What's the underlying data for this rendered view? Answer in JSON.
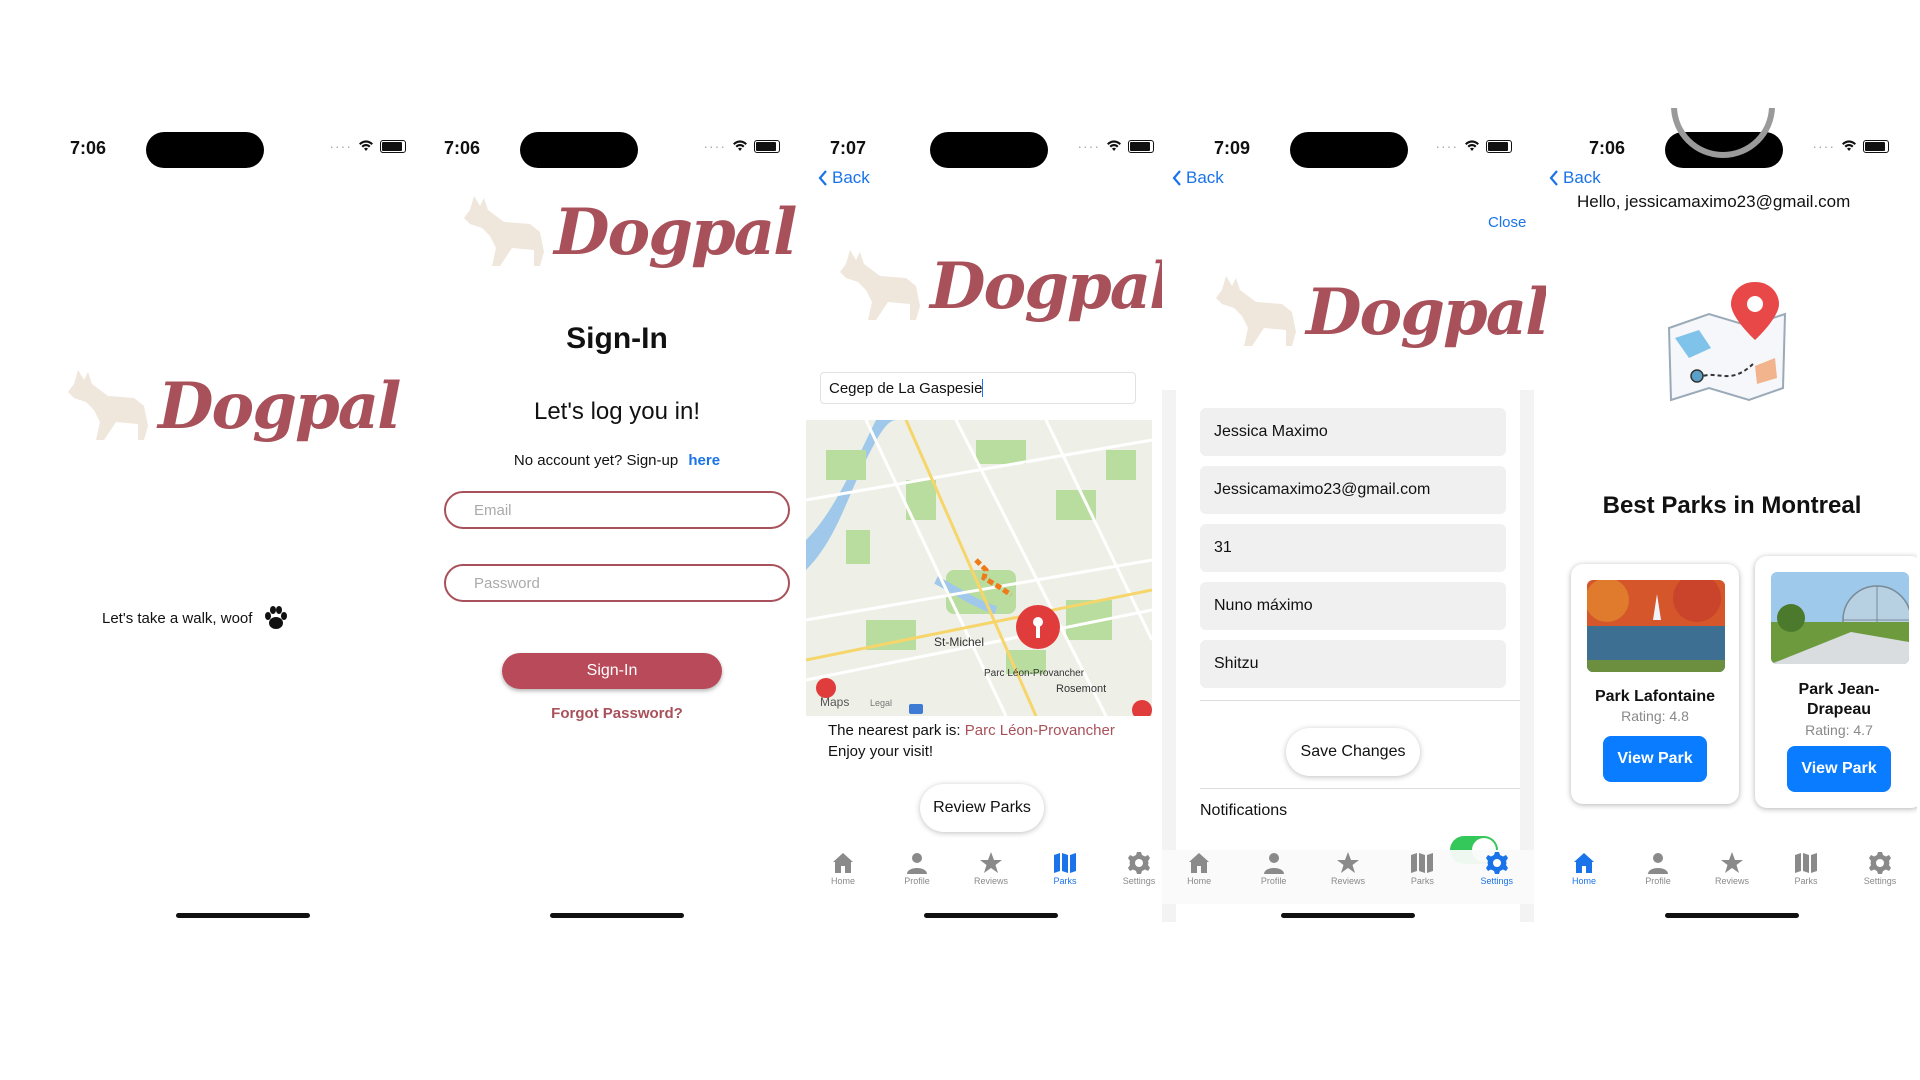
{
  "screens": {
    "splash": {
      "time": "7:06",
      "logo_text": "Dogpal",
      "tagline": "Let's take a walk, woof"
    },
    "signin": {
      "time": "7:06",
      "logo_text": "Dogpal",
      "title": "Sign-In",
      "subtitle": "Let's log you in!",
      "no_account": "No account yet? Sign-up",
      "here_link": "here",
      "email_placeholder": "Email",
      "password_placeholder": "Password",
      "signin_button": "Sign-In",
      "forgot_link": "Forgot Password?"
    },
    "parks": {
      "time": "7:07",
      "back": "Back",
      "logo_text": "Dogpal",
      "search_value": "Cegep de La Gaspesie",
      "map_labels": [
        "St-Michel",
        "Parc Léon-Provancher",
        "Rosemont",
        "Maps",
        "Legal"
      ],
      "nearest_prefix": "The nearest park is:",
      "nearest_park": "Parc Léon-Provancher",
      "enjoy": "Enjoy your visit!",
      "review_button": "Review Parks"
    },
    "settings": {
      "time": "7:09",
      "back": "Back",
      "close": "Close",
      "logo_text": "Dogpal",
      "fields": [
        "Jessica Maximo",
        "Jessicamaximo23@gmail.com",
        "31",
        "Nuno máximo",
        "Shitzu"
      ],
      "save_button": "Save Changes",
      "notifications": "Notifications",
      "toggle_on": true
    },
    "home": {
      "time": "7:06",
      "back": "Back",
      "greeting": "Hello, jessicamaximo23@gmail.com",
      "heading": "Best Parks in Montreal",
      "parks": [
        {
          "name": "Park Lafontaine",
          "rating": "Rating: 4.8",
          "button": "View Park"
        },
        {
          "name": "Park Jean-Drapeau",
          "rating": "Rating: 4.7",
          "button": "View Park"
        }
      ]
    }
  },
  "tabs": [
    "Home",
    "Profile",
    "Reviews",
    "Parks",
    "Settings"
  ],
  "colors": {
    "brand": "#a8515a",
    "accent": "#1a73e8",
    "button_red": "#b84a5a",
    "button_blue": "#0a7cff"
  }
}
